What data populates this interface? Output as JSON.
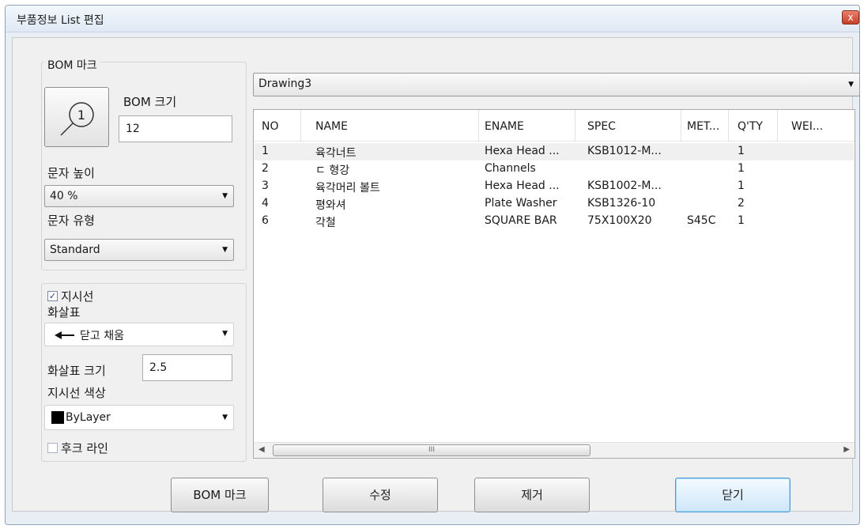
{
  "window": {
    "title": "부품정보 List 편집",
    "close_label": "x"
  },
  "bom_mark": {
    "group_label": "BOM 마크",
    "size_label": "BOM 크기",
    "size_value": "12",
    "icon_glyph": "1",
    "text_height_label": "문자 높이",
    "text_height_value": "40 %",
    "text_type_label": "문자 유형",
    "text_type_value": "Standard"
  },
  "leader": {
    "checkbox_label": "지시선",
    "checked": true,
    "arrow_label": "화살표",
    "arrow_value": "닫고 채움",
    "arrow_size_label": "화살표 크기",
    "arrow_size_value": "2.5",
    "color_label": "지시선 색상",
    "color_value": "ByLayer",
    "color_swatch": "#000000",
    "hook_label": "후크 라인",
    "hook_checked": false
  },
  "drawing_combo": {
    "value": "Drawing3"
  },
  "table": {
    "columns": [
      "NO",
      "NAME",
      "ENAME",
      "SPEC",
      "MET...",
      "Q'TY",
      "WEI..."
    ],
    "rows": [
      [
        "1",
        "육각너트",
        "Hexa Head ...",
        "KSB1012-M...",
        "",
        "1",
        ""
      ],
      [
        "2",
        "ㄷ 형강",
        "Channels",
        "",
        "",
        "1",
        ""
      ],
      [
        "3",
        "육각머리 볼트",
        "Hexa Head ...",
        "KSB1002-M...",
        "",
        "1",
        ""
      ],
      [
        "4",
        "평와셔",
        "Plate Washer",
        "KSB1326-10",
        "",
        "2",
        ""
      ],
      [
        "6",
        "각철",
        "SQUARE BAR",
        "75X100X20",
        "S45C",
        "1",
        ""
      ]
    ],
    "selected_row": 0,
    "scroll_thumb_grip": "III"
  },
  "buttons": {
    "bom_mark": "BOM 마크",
    "edit": "수정",
    "remove": "제거",
    "close": "닫기"
  }
}
